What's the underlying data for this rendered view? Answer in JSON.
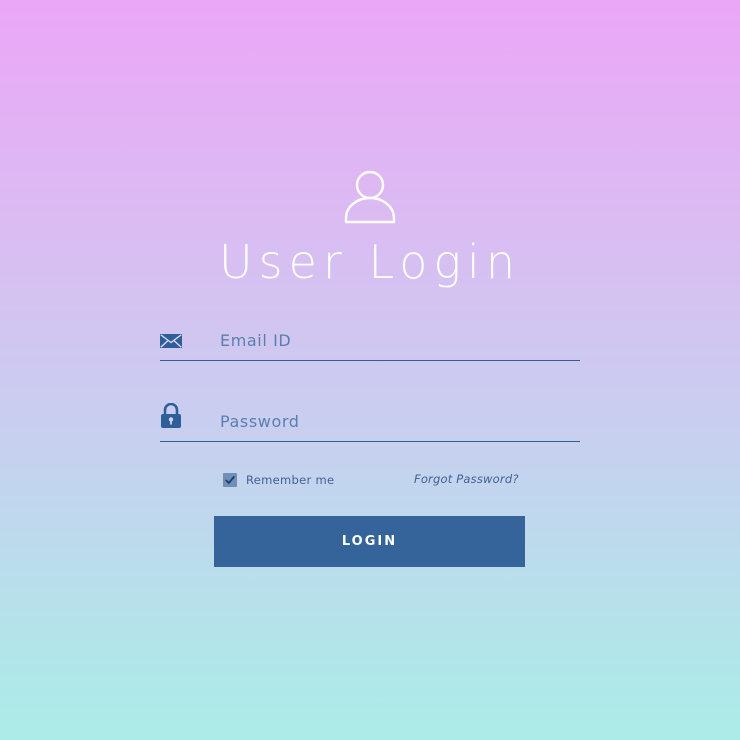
{
  "title": "User Login",
  "email": {
    "placeholder": "Email ID",
    "value": "",
    "icon": "envelope-icon"
  },
  "password": {
    "placeholder": "Password",
    "value": "",
    "icon": "lock-icon"
  },
  "remember": {
    "label": "Remember me",
    "checked": true
  },
  "forgot": {
    "label": "Forgot Password?"
  },
  "login_button": {
    "label": "LOGIN"
  },
  "avatar_icon": "user-avatar-icon",
  "colors": {
    "accent": "#34649a",
    "field_line": "#2f5f98",
    "text": "#3f6394",
    "gradient_top": "#eba6f7",
    "gradient_bottom": "#acece8"
  }
}
